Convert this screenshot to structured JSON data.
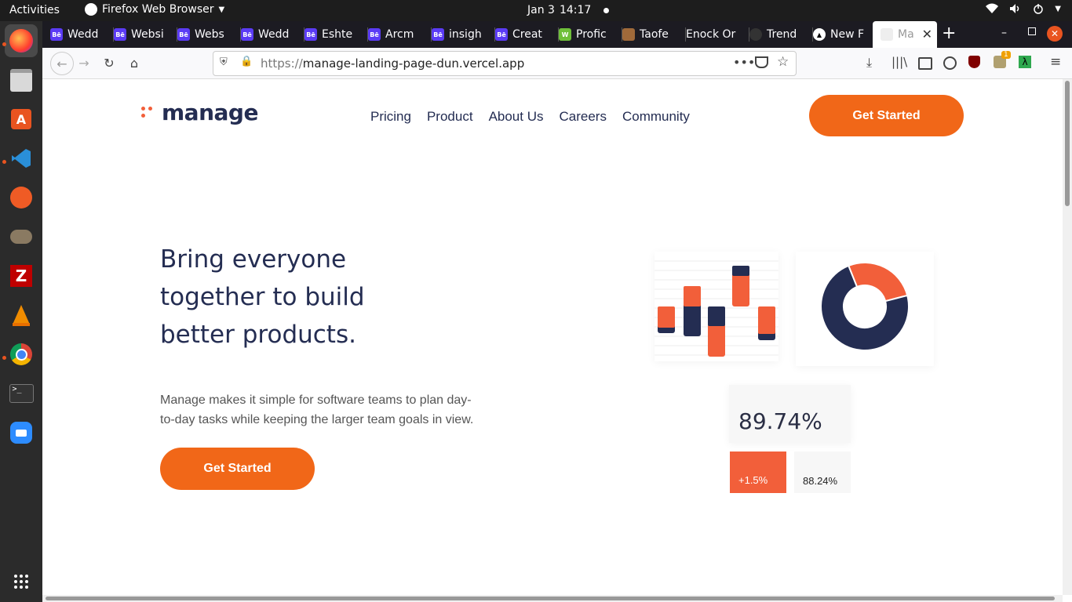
{
  "system": {
    "activities": "Activities",
    "app_menu": "Firefox Web Browser",
    "date": "Jan 3",
    "time": "14:17"
  },
  "tabs": [
    {
      "label": "Wedd",
      "icon": "behance-icon",
      "color": "#5b3bf5"
    },
    {
      "label": "Websi",
      "icon": "behance-icon",
      "color": "#5b3bf5"
    },
    {
      "label": "Webs",
      "icon": "behance-icon",
      "color": "#5b3bf5"
    },
    {
      "label": "Wedd",
      "icon": "behance-icon",
      "color": "#5b3bf5"
    },
    {
      "label": "Eshte",
      "icon": "behance-icon",
      "color": "#5b3bf5"
    },
    {
      "label": "Arcm",
      "icon": "behance-icon",
      "color": "#5b3bf5"
    },
    {
      "label": "insigh",
      "icon": "behance-icon",
      "color": "#5b3bf5"
    },
    {
      "label": "Creat",
      "icon": "behance-icon",
      "color": "#5b3bf5"
    },
    {
      "label": "Profic",
      "icon": "wolfram-icon",
      "color": "#6fbf3a"
    },
    {
      "label": "Taofe",
      "icon": "avatar-icon",
      "color": "#a06a3a"
    },
    {
      "label": "Enock Or",
      "icon": "none",
      "color": "#1c1b22"
    },
    {
      "label": "Trend",
      "icon": "github-icon",
      "color": "#333"
    },
    {
      "label": "New F",
      "icon": "vercel-icon",
      "color": "#fff"
    },
    {
      "label": "Ma",
      "icon": "page-icon",
      "color": "#ccc"
    }
  ],
  "browser": {
    "url_scheme": "https://",
    "url_host": "manage-landing-page-dun.vercel.app",
    "extension_badge": "1"
  },
  "site": {
    "logo": "manage",
    "nav": [
      "Pricing",
      "Product",
      "About Us",
      "Careers",
      "Community"
    ],
    "header_cta": "Get Started",
    "hero_title": "Bring everyone together to build better products.",
    "hero_sub": "Manage makes it simple for software teams to plan day-to-day tasks while keeping the larger team goals in view.",
    "hero_cta": "Get Started",
    "accent": "#f16718",
    "navy": "#242d52"
  },
  "stats": {
    "main": "89.74%",
    "delta": "+1.5%",
    "secondary": "88.24%"
  },
  "chart_data": [
    {
      "type": "pie",
      "values": [
        27,
        73
      ],
      "colors": [
        "#f25f3a",
        "#242d52"
      ]
    }
  ]
}
